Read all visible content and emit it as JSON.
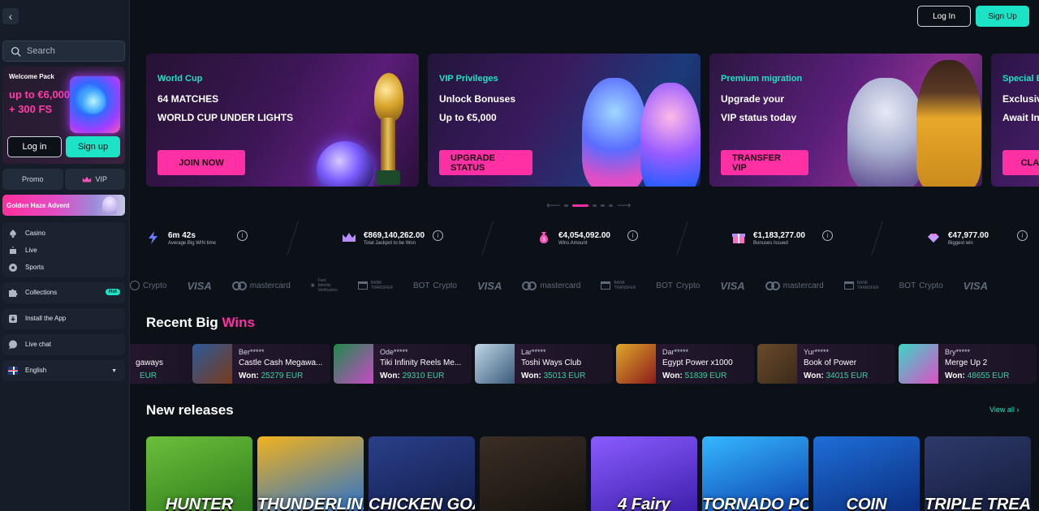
{
  "sidebar": {
    "search_placeholder": "Search",
    "welcome": {
      "title": "Welcome Pack",
      "amount_line1": "up to €6,000",
      "amount_line2": "+ 300 FS"
    },
    "login_label": "Log in",
    "signup_label": "Sign up",
    "tabs": [
      {
        "label": "Promo"
      },
      {
        "label": "VIP"
      }
    ],
    "advent_label": "Golden Haze Advent",
    "nav": [
      {
        "label": "Casino"
      },
      {
        "label": "Live"
      },
      {
        "label": "Sports"
      }
    ],
    "collections_label": "Collections",
    "hot_badge": "Hot",
    "install_label": "Install the App",
    "livechat_label": "Live chat",
    "language": "English"
  },
  "header": {
    "login_label": "Log In",
    "signup_label": "Sign Up"
  },
  "banners": [
    {
      "kicker": "World Cup",
      "line1": "64 MATCHES",
      "line2": "WORLD CUP UNDER LIGHTS",
      "cta": "JOIN NOW"
    },
    {
      "kicker": "VIP Privileges",
      "line1": "Unlock Bonuses",
      "line2": "Up to €5,000",
      "cta": "UPGRADE STATUS"
    },
    {
      "kicker": "Premium migration",
      "line1": "Upgrade your",
      "line2": "VIP status today",
      "cta": "TRANSFER VIP"
    },
    {
      "kicker": "Special B",
      "line1": "Exclusiv",
      "line2": "Await In",
      "cta": "CLAIM"
    }
  ],
  "carousel": {
    "slides": 5,
    "active_index": 1
  },
  "stats": [
    {
      "value": "6m 42s",
      "label": "Average Big WIN time",
      "icon": "lightning-icon"
    },
    {
      "value": "€869,140,262.00",
      "label": "Total Jackpot to be Won",
      "icon": "crown-icon"
    },
    {
      "value": "€4,054,092.00",
      "label": "Wins Amount",
      "icon": "money-bag-icon"
    },
    {
      "value": "€1,183,277.00",
      "label": "Bonuses Issued",
      "icon": "gift-icon"
    },
    {
      "value": "€47,977.00",
      "label": "Biggest win",
      "icon": "diamond-icon"
    }
  ],
  "payments": {
    "crypto": "Crypto",
    "visa": "VISA",
    "mastercard": "mastercard",
    "identity_1": "Fast",
    "identity_2": "Identity",
    "identity_3": "Verification",
    "bank_1": "BANK",
    "bank_2": "TRANSFER",
    "other": "BOT"
  },
  "recent_wins": {
    "title_main": "Recent Big ",
    "title_accent": "Wins",
    "won_label": "Won:",
    "items": [
      {
        "game": "gaways",
        "amount": "EUR"
      },
      {
        "name": "Ber*****",
        "game": "Castle Cash Megawa...",
        "amount": "25279 EUR"
      },
      {
        "name": "Ode*****",
        "game": "Tiki Infinity Reels Me...",
        "amount": "29310 EUR"
      },
      {
        "name": "Lar*****",
        "game": "Toshi Ways Club",
        "amount": "35013 EUR"
      },
      {
        "name": "Dar*****",
        "game": "Egypt Power x1000",
        "amount": "51839 EUR"
      },
      {
        "name": "Yur*****",
        "game": "Book of Power",
        "amount": "34015 EUR"
      },
      {
        "name": "Bry*****",
        "game": "Merge Up 2",
        "amount": "48655 EUR"
      }
    ]
  },
  "new_releases": {
    "title": "New releases",
    "view_all": "View all",
    "games": [
      {
        "title": "HUNTER",
        "colors": [
          "#6bbf3a",
          "#2d7a1c"
        ]
      },
      {
        "title": "THUNDERLINE",
        "colors": [
          "#f2b21d",
          "#1e6ed8"
        ]
      },
      {
        "title": "CHICKEN GOAL",
        "colors": [
          "#2a3f8a",
          "#121d4a"
        ]
      },
      {
        "title": "",
        "colors": [
          "#3a2e26",
          "#15110d"
        ]
      },
      {
        "title": "4 Fairy",
        "colors": [
          "#8a5cff",
          "#3a1ca8"
        ]
      },
      {
        "title": "TORNADO POWER",
        "colors": [
          "#35b8ff",
          "#0a3aa8"
        ]
      },
      {
        "title": "COIN",
        "colors": [
          "#1e6ed8",
          "#0a2a7a"
        ]
      },
      {
        "title": "TRIPLE TREASURE",
        "colors": [
          "#2e3a6a",
          "#121a3a"
        ]
      }
    ]
  }
}
